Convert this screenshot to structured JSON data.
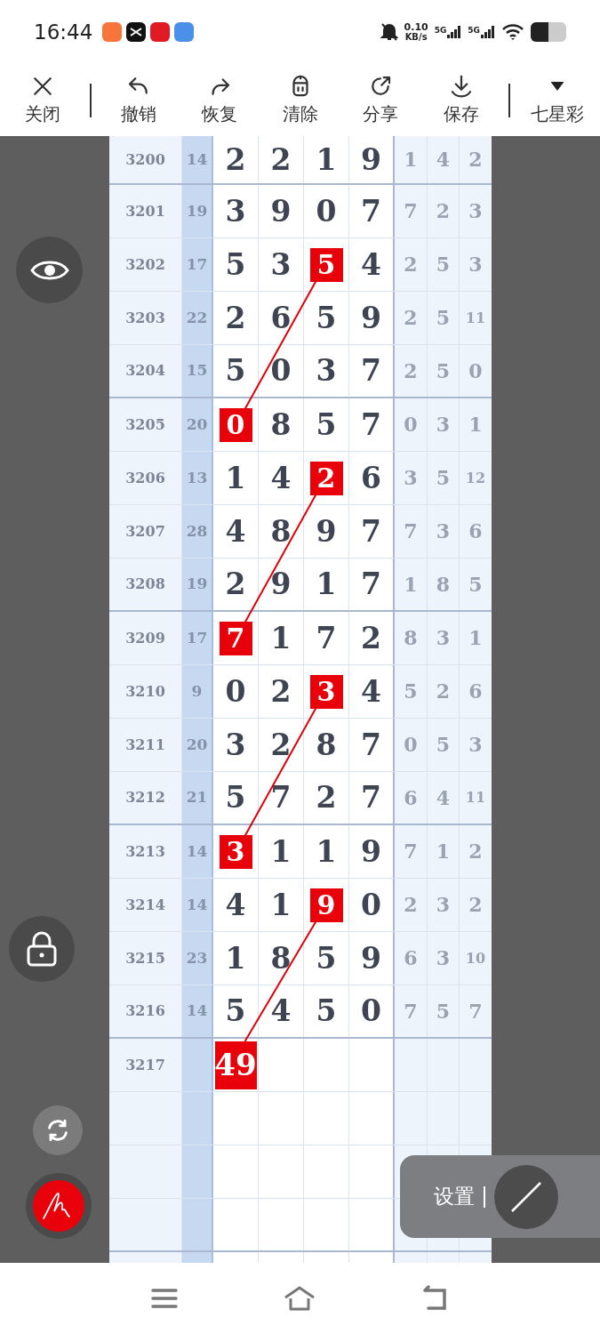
{
  "status_bar": {
    "time": "16:44",
    "net_speed": "0.10",
    "net_unit": "KB/s",
    "signals": [
      "5G",
      "5G"
    ]
  },
  "toolbar": [
    {
      "kind": "close",
      "label": "关闭"
    },
    {
      "kind": "undo",
      "label": "撤销"
    },
    {
      "kind": "redo",
      "label": "恢复"
    },
    {
      "kind": "clear",
      "label": "清除"
    },
    {
      "kind": "share",
      "label": "分享"
    },
    {
      "kind": "save",
      "label": "保存"
    },
    {
      "kind": "dropdown",
      "label": "七星彩"
    }
  ],
  "chart": {
    "rows": [
      {
        "issue": "3200",
        "sum": "14",
        "digits": [
          {
            "value": "2",
            "highlighted": false
          },
          {
            "value": "2",
            "highlighted": false
          },
          {
            "value": "1",
            "highlighted": false
          },
          {
            "value": "9",
            "highlighted": false
          }
        ],
        "stats": [
          "1",
          "4",
          "2"
        ]
      },
      {
        "issue": "3201",
        "sum": "19",
        "digits": [
          {
            "value": "3",
            "highlighted": false
          },
          {
            "value": "9",
            "highlighted": false
          },
          {
            "value": "0",
            "highlighted": false
          },
          {
            "value": "7",
            "highlighted": false
          }
        ],
        "stats": [
          "7",
          "2",
          "3"
        ]
      },
      {
        "issue": "3202",
        "sum": "17",
        "digits": [
          {
            "value": "5",
            "highlighted": false
          },
          {
            "value": "3",
            "highlighted": false
          },
          {
            "value": "5",
            "highlighted": true
          },
          {
            "value": "4",
            "highlighted": false
          }
        ],
        "stats": [
          "2",
          "5",
          "3"
        ]
      },
      {
        "issue": "3203",
        "sum": "22",
        "digits": [
          {
            "value": "2",
            "highlighted": false
          },
          {
            "value": "6",
            "highlighted": false
          },
          {
            "value": "5",
            "highlighted": false
          },
          {
            "value": "9",
            "highlighted": false
          }
        ],
        "stats": [
          "2",
          "5",
          "11"
        ]
      },
      {
        "issue": "3204",
        "sum": "15",
        "digits": [
          {
            "value": "5",
            "highlighted": false
          },
          {
            "value": "0",
            "highlighted": false
          },
          {
            "value": "3",
            "highlighted": false
          },
          {
            "value": "7",
            "highlighted": false
          }
        ],
        "stats": [
          "2",
          "5",
          "0"
        ]
      },
      {
        "issue": "3205",
        "sum": "20",
        "digits": [
          {
            "value": "0",
            "highlighted": true
          },
          {
            "value": "8",
            "highlighted": false
          },
          {
            "value": "5",
            "highlighted": false
          },
          {
            "value": "7",
            "highlighted": false
          }
        ],
        "stats": [
          "0",
          "3",
          "1"
        ]
      },
      {
        "issue": "3206",
        "sum": "13",
        "digits": [
          {
            "value": "1",
            "highlighted": false
          },
          {
            "value": "4",
            "highlighted": false
          },
          {
            "value": "2",
            "highlighted": true
          },
          {
            "value": "6",
            "highlighted": false
          }
        ],
        "stats": [
          "3",
          "5",
          "12"
        ]
      },
      {
        "issue": "3207",
        "sum": "28",
        "digits": [
          {
            "value": "4",
            "highlighted": false
          },
          {
            "value": "8",
            "highlighted": false
          },
          {
            "value": "9",
            "highlighted": false
          },
          {
            "value": "7",
            "highlighted": false
          }
        ],
        "stats": [
          "7",
          "3",
          "6"
        ]
      },
      {
        "issue": "3208",
        "sum": "19",
        "digits": [
          {
            "value": "2",
            "highlighted": false
          },
          {
            "value": "9",
            "highlighted": false
          },
          {
            "value": "1",
            "highlighted": false
          },
          {
            "value": "7",
            "highlighted": false
          }
        ],
        "stats": [
          "1",
          "8",
          "5"
        ]
      },
      {
        "issue": "3209",
        "sum": "17",
        "digits": [
          {
            "value": "7",
            "highlighted": true
          },
          {
            "value": "1",
            "highlighted": false
          },
          {
            "value": "7",
            "highlighted": false
          },
          {
            "value": "2",
            "highlighted": false
          }
        ],
        "stats": [
          "8",
          "3",
          "1"
        ]
      },
      {
        "issue": "3210",
        "sum": "9",
        "digits": [
          {
            "value": "0",
            "highlighted": false
          },
          {
            "value": "2",
            "highlighted": false
          },
          {
            "value": "3",
            "highlighted": true
          },
          {
            "value": "4",
            "highlighted": false
          }
        ],
        "stats": [
          "5",
          "2",
          "6"
        ]
      },
      {
        "issue": "3211",
        "sum": "20",
        "digits": [
          {
            "value": "3",
            "highlighted": false
          },
          {
            "value": "2",
            "highlighted": false
          },
          {
            "value": "8",
            "highlighted": false
          },
          {
            "value": "7",
            "highlighted": false
          }
        ],
        "stats": [
          "0",
          "5",
          "3"
        ]
      },
      {
        "issue": "3212",
        "sum": "21",
        "digits": [
          {
            "value": "5",
            "highlighted": false
          },
          {
            "value": "7",
            "highlighted": false
          },
          {
            "value": "2",
            "highlighted": false
          },
          {
            "value": "7",
            "highlighted": false
          }
        ],
        "stats": [
          "6",
          "4",
          "11"
        ]
      },
      {
        "issue": "3213",
        "sum": "14",
        "digits": [
          {
            "value": "3",
            "highlighted": true
          },
          {
            "value": "1",
            "highlighted": false
          },
          {
            "value": "1",
            "highlighted": false
          },
          {
            "value": "9",
            "highlighted": false
          }
        ],
        "stats": [
          "7",
          "1",
          "2"
        ]
      },
      {
        "issue": "3214",
        "sum": "14",
        "digits": [
          {
            "value": "4",
            "highlighted": false
          },
          {
            "value": "1",
            "highlighted": false
          },
          {
            "value": "9",
            "highlighted": true
          },
          {
            "value": "0",
            "highlighted": false
          }
        ],
        "stats": [
          "2",
          "3",
          "2"
        ]
      },
      {
        "issue": "3215",
        "sum": "23",
        "digits": [
          {
            "value": "1",
            "highlighted": false
          },
          {
            "value": "8",
            "highlighted": false
          },
          {
            "value": "5",
            "highlighted": false
          },
          {
            "value": "9",
            "highlighted": false
          }
        ],
        "stats": [
          "6",
          "3",
          "10"
        ]
      },
      {
        "issue": "3216",
        "sum": "14",
        "digits": [
          {
            "value": "5",
            "highlighted": false
          },
          {
            "value": "4",
            "highlighted": false
          },
          {
            "value": "5",
            "highlighted": false
          },
          {
            "value": "0",
            "highlighted": false
          }
        ],
        "stats": [
          "7",
          "5",
          "7"
        ]
      },
      {
        "issue": "3217",
        "digits": [
          {
            "value": "49",
            "highlighted": true
          }
        ]
      }
    ]
  },
  "settings_panel": {
    "label": "设置"
  }
}
